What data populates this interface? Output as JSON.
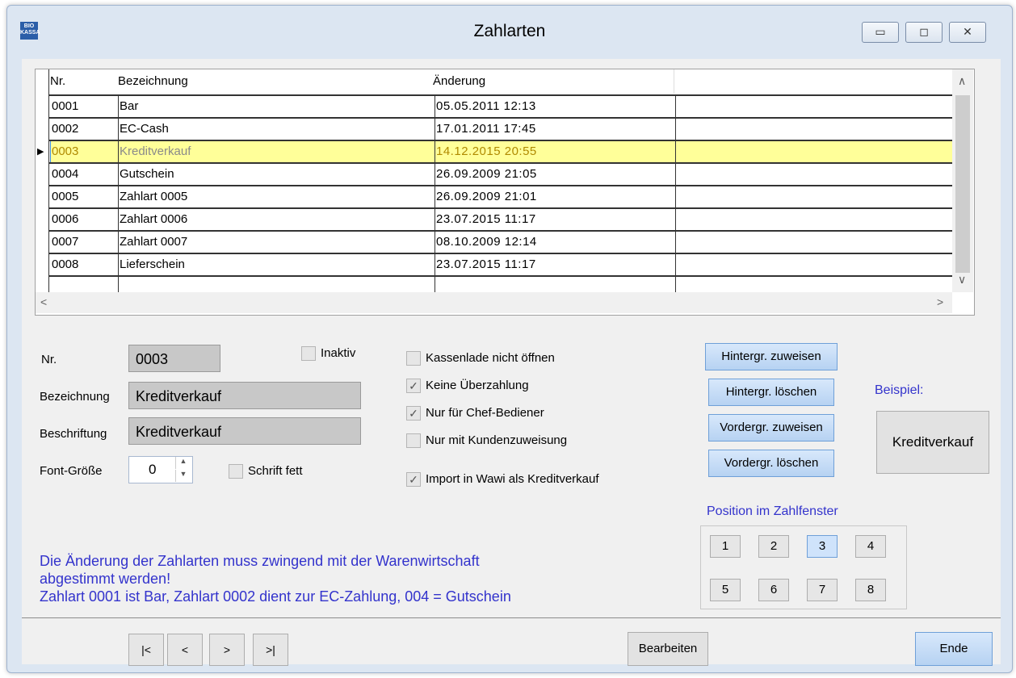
{
  "window": {
    "title": "Zahlarten",
    "app_icon_text": "BIO KASSA"
  },
  "grid": {
    "columns": [
      "Nr.",
      "Bezeichnung",
      "Änderung"
    ],
    "rows": [
      {
        "nr": "0001",
        "bez": "Bar",
        "aend": "05.05.2011 12:13"
      },
      {
        "nr": "0002",
        "bez": "EC-Cash",
        "aend": "17.01.2011 17:45"
      },
      {
        "nr": "0003",
        "bez": "Kreditverkauf",
        "aend": "14.12.2015 20:55"
      },
      {
        "nr": "0004",
        "bez": "Gutschein",
        "aend": "26.09.2009 21:05"
      },
      {
        "nr": "0005",
        "bez": "Zahlart 0005",
        "aend": "26.09.2009 21:01"
      },
      {
        "nr": "0006",
        "bez": "Zahlart 0006",
        "aend": "23.07.2015 11:17"
      },
      {
        "nr": "0007",
        "bez": "Zahlart 0007",
        "aend": "08.10.2009 12:14"
      },
      {
        "nr": "0008",
        "bez": "Lieferschein",
        "aend": "23.07.2015 11:17"
      }
    ],
    "selected_row": "0003"
  },
  "form": {
    "nr_label": "Nr.",
    "nr_value": "0003",
    "inaktiv_label": "Inaktiv",
    "bezeichnung_label": "Bezeichnung",
    "bezeichnung_value": "Kreditverkauf",
    "beschriftung_label": "Beschriftung",
    "beschriftung_value": "Kreditverkauf",
    "fontsize_label": "Font-Größe",
    "fontsize_value": "0",
    "bold_label": "Schrift fett"
  },
  "options": [
    {
      "label": "Kassenlade nicht öffnen",
      "checked": false
    },
    {
      "label": "Keine Überzahlung",
      "checked": true
    },
    {
      "label": "Nur für Chef-Bediener",
      "checked": true
    },
    {
      "label": "Nur mit Kundenzuweisung",
      "checked": false
    },
    {
      "label": "Import in Wawi als Kreditverkauf",
      "checked": true
    }
  ],
  "color_buttons": {
    "bg_assign": "Hintergr. zuweisen",
    "bg_delete": "Hintergr. löschen",
    "fg_assign": "Vordergr. zuweisen",
    "fg_delete": "Vordergr. löschen"
  },
  "example": {
    "label": "Beispiel:",
    "text": "Kreditverkauf"
  },
  "position": {
    "label": "Position im Zahlfenster",
    "buttons": [
      "1",
      "2",
      "3",
      "4",
      "5",
      "6",
      "7",
      "8"
    ],
    "selected": "3"
  },
  "notes": [
    "Die Änderung der Zahlarten muss zwingend mit der Warenwirtschaft",
    "abgestimmt werden!",
    "Zahlart 0001 ist Bar, Zahlart 0002 dient zur EC-Zahlung, 004 = Gutschein"
  ],
  "nav": {
    "first": "|<",
    "prev": "<",
    "next": ">",
    "last": ">|"
  },
  "actions": {
    "edit": "Bearbeiten",
    "end": "Ende"
  },
  "colors": {
    "selected_row_bg": "#ffff99",
    "note_text": "#3333cc",
    "accent_button": "#b6d2f2"
  }
}
